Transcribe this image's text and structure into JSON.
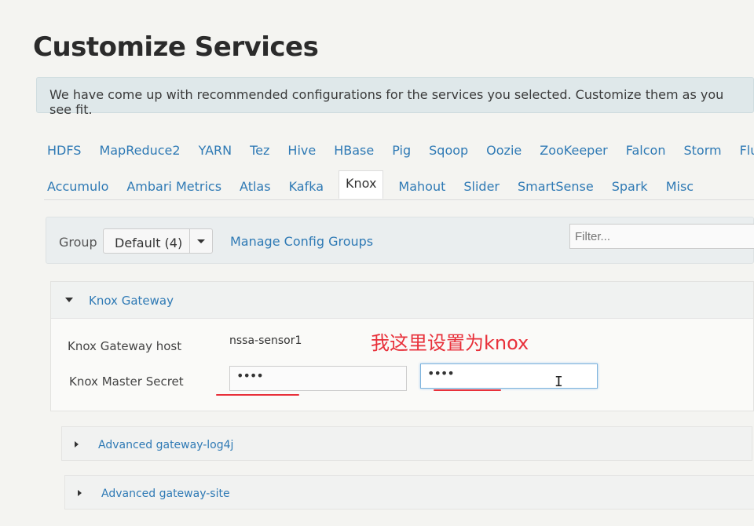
{
  "page": {
    "title": "Customize Services"
  },
  "banner": {
    "text": "We have come up with recommended configurations for the services you selected. Customize them as you see fit."
  },
  "tabs": {
    "row1": [
      "HDFS",
      "MapReduce2",
      "YARN",
      "Tez",
      "Hive",
      "HBase",
      "Pig",
      "Sqoop",
      "Oozie",
      "ZooKeeper",
      "Falcon",
      "Storm",
      "Flu"
    ],
    "row2": [
      "Accumulo",
      "Ambari Metrics",
      "Atlas",
      "Kafka",
      "Knox",
      "Mahout",
      "Slider",
      "SmartSense",
      "Spark",
      "Misc"
    ],
    "active": "Knox"
  },
  "toolbar": {
    "group_label": "Group",
    "group_value": "Default (4)",
    "manage_link": "Manage Config Groups",
    "filter_placeholder": "Filter..."
  },
  "gateway_section": {
    "title": "Knox Gateway",
    "host_label": "Knox Gateway host",
    "host_value": "nssa-sensor1",
    "secret_label": "Knox Master Secret",
    "secret_value": "••••",
    "secret_confirm_value": "••••"
  },
  "annotation": {
    "text": "我这里设置为knox",
    "color": "#e8303a"
  },
  "advanced_sections": [
    "Advanced gateway-log4j",
    "Advanced gateway-site"
  ],
  "colors": {
    "link": "#2f7ab5",
    "banner_bg": "#dfe8ea",
    "annotation": "#e8303a"
  }
}
